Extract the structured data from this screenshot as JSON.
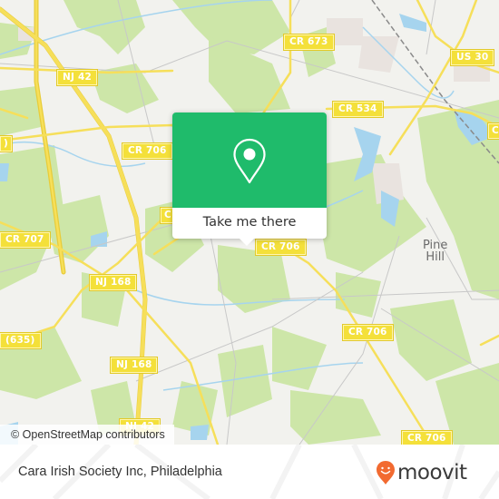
{
  "map": {
    "road_shields": [
      {
        "id": "nj42-top",
        "label": "NJ 42"
      },
      {
        "id": "cr673",
        "label": "CR 673"
      },
      {
        "id": "us30",
        "label": "US 30"
      },
      {
        "id": "cr534",
        "label": "CR 534"
      },
      {
        "id": "cr706-left",
        "label": "CR 706"
      },
      {
        "id": "cr706-center",
        "label": "CR 706"
      },
      {
        "id": "cr707",
        "label": "CR 707"
      },
      {
        "id": "nj168-mid",
        "label": "NJ 168"
      },
      {
        "id": "cr635",
        "label": "(635)"
      },
      {
        "id": "nj168-low",
        "label": "NJ 168"
      },
      {
        "id": "cr706-right",
        "label": "CR 706"
      },
      {
        "id": "cr706-bottom",
        "label": "CR 706"
      },
      {
        "id": "nj42-bottom",
        "label": "NJ 42"
      },
      {
        "id": "edge-left",
        "label": ")"
      },
      {
        "id": "edge-right",
        "label": "C"
      },
      {
        "id": "edge-mid",
        "label": "C"
      }
    ],
    "place_label": {
      "line1": "Pine",
      "line2": "Hill"
    },
    "attribution": "© OpenStreetMap contributors",
    "colors": {
      "land": "#f2f2ee",
      "park": "#cde6a8",
      "water": "#a6d4ee",
      "road": "#f6df5a",
      "minor_road": "#bdbdbd",
      "rail": "#8a8a8a"
    }
  },
  "popup": {
    "icon": "location-pin-icon",
    "button_label": "Take me there",
    "accent_color": "#1fbb6b"
  },
  "footer": {
    "title": "Cara Irish Society Inc, Philadelphia",
    "logo_text": "moovit",
    "logo_icon": "moovit-smiley-pin-icon",
    "logo_color": "#f26a30"
  }
}
